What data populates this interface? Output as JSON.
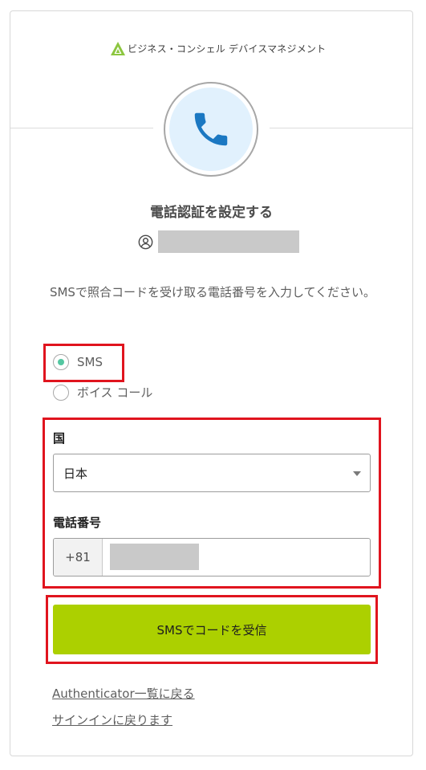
{
  "brand": {
    "name": "ビジネス・コンシェル デバイスマネジメント",
    "logo_color": "#8cc63f"
  },
  "header": {
    "icon": "phone-icon",
    "icon_color": "#1b78c2",
    "circle_fill": "#e1f1fd"
  },
  "title": "電話認証を設定する",
  "user": {
    "icon": "user-circle-icon"
  },
  "instruction": "SMSで照合コードを受け取る電話番号を入力してください。",
  "methods": {
    "selected": "SMS",
    "options": [
      {
        "label": "SMS",
        "checked": true
      },
      {
        "label": "ボイス コール",
        "checked": false
      }
    ]
  },
  "country": {
    "label": "国",
    "value": "日本"
  },
  "phone": {
    "label": "電話番号",
    "prefix": "+81"
  },
  "submit": {
    "label": "SMSでコードを受信",
    "color": "#acd000"
  },
  "links": {
    "back": "Authenticator一覧に戻る",
    "signin": "サインインに戻ります"
  },
  "highlight_color": "#e0141e"
}
